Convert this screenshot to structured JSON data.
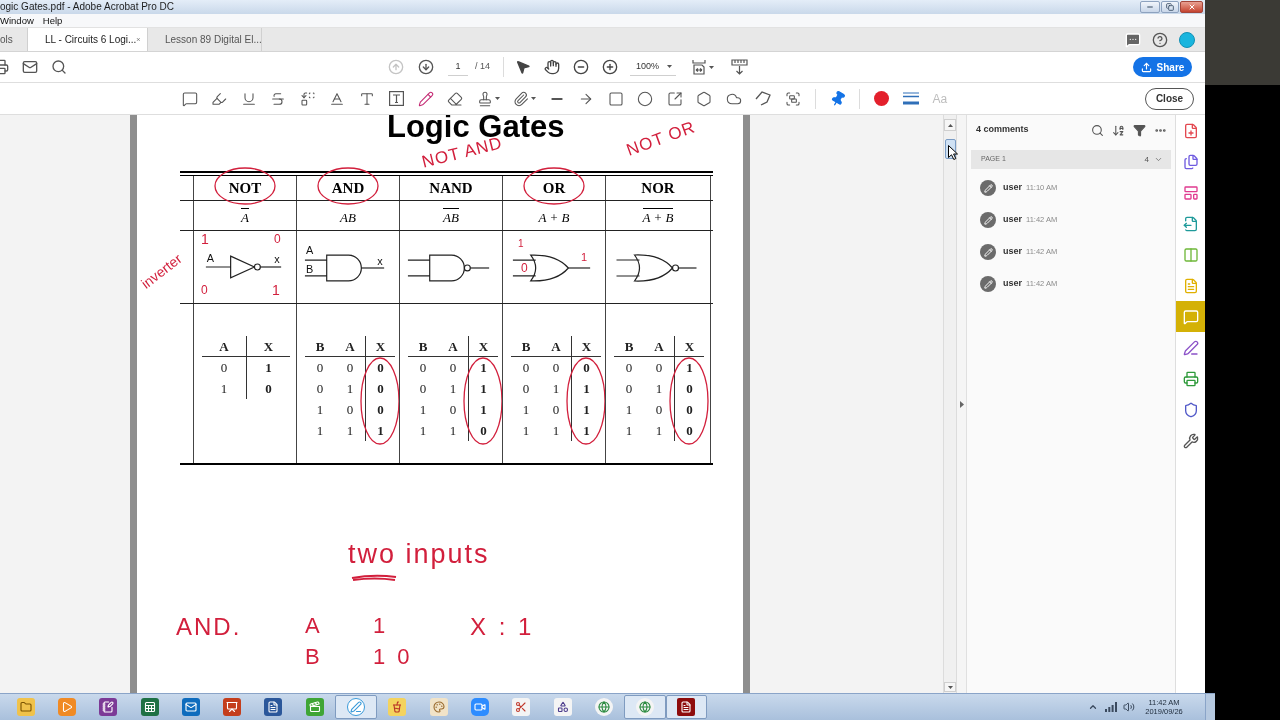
{
  "window": {
    "title": "ogic Gates.pdf - Adobe Acrobat Pro DC"
  },
  "menu": [
    "Window",
    "Help"
  ],
  "tabs": [
    {
      "label": "ols",
      "selected": false
    },
    {
      "label": "LL - Circuits 6 Logi...",
      "selected": true
    },
    {
      "label": "Lesson 89 Digital El...",
      "selected": false
    }
  ],
  "toolbar": {
    "prev_page_disabled": true,
    "page_number": "1",
    "page_total": "/ 14",
    "zoom": "100%",
    "share_button": "Share"
  },
  "comment_toolbar": {
    "font_button": {
      "label": "Aa",
      "disabled": true
    },
    "close_button": "Close"
  },
  "document": {
    "title": "Logic Gates",
    "gates": [
      {
        "name": "NOT",
        "kind": "not",
        "circled": true,
        "expression": "A",
        "negated": true,
        "pin_labels": [
          "A",
          "x"
        ],
        "truth_table": {
          "columns": [
            "A",
            "X"
          ],
          "rows": [
            [
              "0",
              "1"
            ],
            [
              "1",
              "0"
            ]
          ],
          "output_circled": false
        }
      },
      {
        "name": "AND",
        "kind": "and",
        "circled": true,
        "expression": "AB",
        "negated": false,
        "pin_labels": [
          "A",
          "B",
          "x"
        ],
        "truth_table": {
          "columns": [
            "B",
            "A",
            "X"
          ],
          "rows": [
            [
              "0",
              "0",
              "0"
            ],
            [
              "0",
              "1",
              "0"
            ],
            [
              "1",
              "0",
              "0"
            ],
            [
              "1",
              "1",
              "1"
            ]
          ],
          "output_circled": true
        }
      },
      {
        "name": "NAND",
        "kind": "nand",
        "circled": false,
        "expression": "AB",
        "negated": true,
        "truth_table": {
          "columns": [
            "B",
            "A",
            "X"
          ],
          "rows": [
            [
              "0",
              "0",
              "1"
            ],
            [
              "0",
              "1",
              "1"
            ],
            [
              "1",
              "0",
              "1"
            ],
            [
              "1",
              "1",
              "0"
            ]
          ],
          "output_circled": true
        }
      },
      {
        "name": "OR",
        "kind": "or",
        "circled": true,
        "expression": "A + B",
        "negated": false,
        "truth_table": {
          "columns": [
            "B",
            "A",
            "X"
          ],
          "rows": [
            [
              "0",
              "0",
              "0"
            ],
            [
              "0",
              "1",
              "1"
            ],
            [
              "1",
              "0",
              "1"
            ],
            [
              "1",
              "1",
              "1"
            ]
          ],
          "output_circled": true
        }
      },
      {
        "name": "NOR",
        "kind": "nor",
        "circled": false,
        "expression": "A + B",
        "negated": true,
        "truth_table": {
          "columns": [
            "B",
            "A",
            "X"
          ],
          "rows": [
            [
              "0",
              "0",
              "1"
            ],
            [
              "0",
              "1",
              "0"
            ],
            [
              "1",
              "0",
              "0"
            ],
            [
              "1",
              "1",
              "0"
            ]
          ],
          "output_circled": true
        }
      }
    ],
    "ink": [
      {
        "text": "NOT AND"
      },
      {
        "text": "NOT OR"
      },
      {
        "text": "inverter"
      },
      {
        "text": "1"
      },
      {
        "text": "0"
      },
      {
        "text": "0"
      },
      {
        "text": "1"
      },
      {
        "text": "1"
      },
      {
        "text": "0"
      },
      {
        "text": "1"
      },
      {
        "text": "two inputs"
      },
      {
        "text": "AND."
      },
      {
        "text": "A"
      },
      {
        "text": "1"
      },
      {
        "text": "X : 1"
      },
      {
        "text": "B"
      },
      {
        "text": "1 0"
      }
    ]
  },
  "comments_panel": {
    "count_label": "4 comments",
    "page_label": "PAGE 1",
    "page_count": "4",
    "comments": [
      {
        "author": "user",
        "time": "11:10 AM"
      },
      {
        "author": "user",
        "time": "11:42 AM"
      },
      {
        "author": "user",
        "time": "11:42 AM"
      },
      {
        "author": "user",
        "time": "11:42 AM"
      }
    ]
  },
  "tools_rail": [
    {
      "kind": "create-pdf",
      "selected": false
    },
    {
      "kind": "combine-files",
      "selected": false
    },
    {
      "kind": "organize-pages",
      "selected": false
    },
    {
      "kind": "export-pdf",
      "selected": false
    },
    {
      "kind": "compare",
      "selected": false
    },
    {
      "kind": "send-comments",
      "selected": false
    },
    {
      "kind": "comment",
      "selected": true
    },
    {
      "kind": "fill-sign",
      "selected": false
    },
    {
      "kind": "print-production",
      "selected": false
    },
    {
      "kind": "protect",
      "selected": false
    },
    {
      "kind": "more-tools",
      "selected": false
    }
  ],
  "taskbar": {
    "apps": [
      {
        "kind": "file-manager",
        "open": false
      },
      {
        "kind": "media-player",
        "open": false
      },
      {
        "kind": "notebook",
        "open": false
      },
      {
        "kind": "spreadsheet",
        "open": false
      },
      {
        "kind": "mail",
        "open": false
      },
      {
        "kind": "presentation",
        "open": false
      },
      {
        "kind": "word-processor",
        "open": false
      },
      {
        "kind": "screen-recorder",
        "open": false
      },
      {
        "kind": "writer",
        "open": true
      },
      {
        "kind": "drink",
        "open": false
      },
      {
        "kind": "paint",
        "open": false
      },
      {
        "kind": "video-call",
        "open": false
      },
      {
        "kind": "snipping",
        "open": false
      },
      {
        "kind": "geometry",
        "open": false
      },
      {
        "kind": "browser",
        "open": false
      },
      {
        "kind": "browser",
        "open": true
      },
      {
        "kind": "pdf-reader",
        "open": true
      }
    ],
    "time": "11:42 AM",
    "date": "2019/09/26"
  }
}
